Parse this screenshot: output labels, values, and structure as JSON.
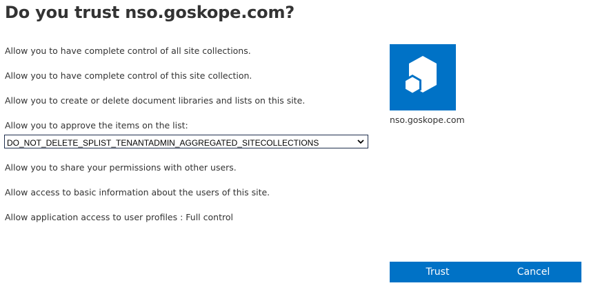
{
  "dialog": {
    "title": "Do you trust nso.goskope.com?"
  },
  "permissions": [
    "Allow you to have complete control of all site collections.",
    "Allow you to have complete control of this site collection.",
    "Allow you to create or delete document libraries and lists on this site.",
    "Allow you to approve the items on the list:",
    "Allow you to share your permissions with other users.",
    "Allow access to basic information about the users of this site.",
    "Allow application access to user profiles : Full  control"
  ],
  "list_select": {
    "selected": "DO_NOT_DELETE_SPLIST_TENANTADMIN_AGGREGATED_SITECOLLECTIONS"
  },
  "app": {
    "name": "nso.goskope.com",
    "icon": "app-cube-icon",
    "tile_color": "#0072c6"
  },
  "actions": {
    "trust_label": "Trust",
    "cancel_label": "Cancel",
    "button_color": "#0072c6"
  }
}
